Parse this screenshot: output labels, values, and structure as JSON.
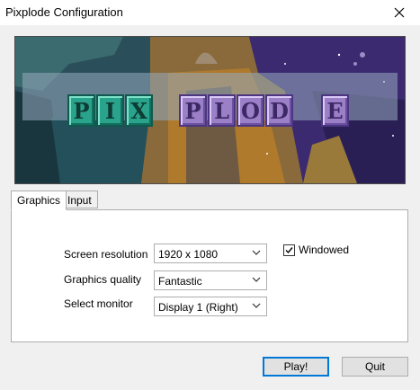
{
  "window": {
    "title": "Pixplode Configuration"
  },
  "banner": {
    "logo_letters": [
      "P",
      "I",
      "X",
      "P",
      "L",
      "O",
      "D",
      "E"
    ],
    "logo_colors": {
      "teal": "#2aa38c",
      "purple": "#9b80c8"
    }
  },
  "tabs": [
    {
      "label": "Graphics",
      "active": true
    },
    {
      "label": "Input",
      "active": false
    }
  ],
  "graphics": {
    "resolution": {
      "label": "Screen resolution",
      "value": "1920 x 1080"
    },
    "quality": {
      "label": "Graphics quality",
      "value": "Fantastic"
    },
    "monitor": {
      "label": "Select monitor",
      "value": "Display 1 (Right)"
    },
    "windowed": {
      "label": "Windowed",
      "checked": true
    }
  },
  "buttons": {
    "play": "Play!",
    "quit": "Quit"
  },
  "colors": {
    "accent": "#0078d7",
    "window_bg": "#f0f0f0"
  }
}
